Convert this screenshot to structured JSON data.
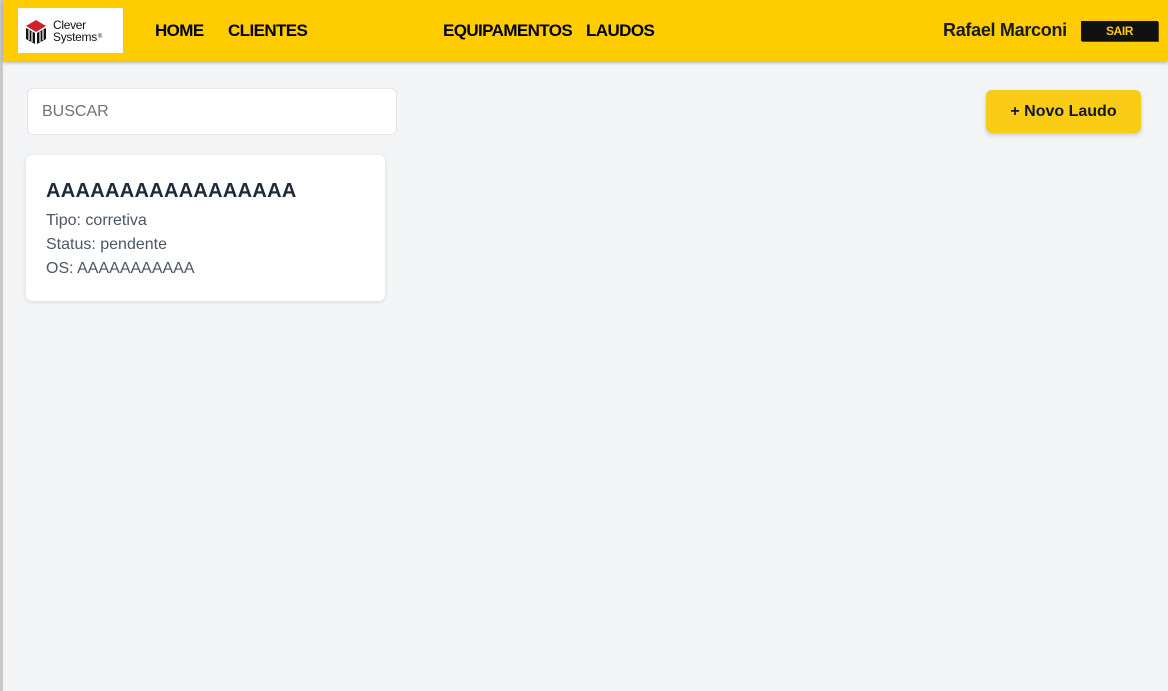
{
  "brand": {
    "logo_line1": "Clever",
    "logo_line2": "Systems",
    "logo_reg": "®",
    "accent_color": "#ffcc00",
    "logo_icon": "clever-systems-logo-icon"
  },
  "nav": {
    "home": "HOME",
    "clientes": "CLIENTES",
    "equipamentos": "EQUIPAMENTOS",
    "laudos": "LAUDOS"
  },
  "user": {
    "name": "Rafael Marconi",
    "logout_label": "SAIR"
  },
  "search": {
    "placeholder": "BUSCAR",
    "value": ""
  },
  "actions": {
    "new_report_label": "+ Novo Laudo"
  },
  "reports": [
    {
      "title": "AAAAAAAAAAAAAAAAA",
      "tipo": "Tipo: corretiva",
      "status": "Status: pendente",
      "os": "OS: AAAAAAAAAAA"
    }
  ]
}
